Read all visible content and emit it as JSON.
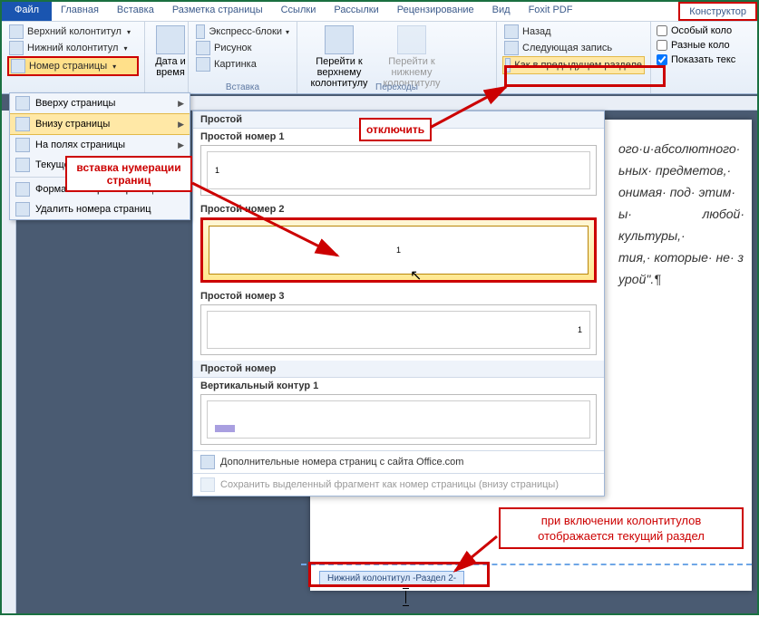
{
  "tabs": {
    "file": "Файл",
    "home": "Главная",
    "insert": "Вставка",
    "layout": "Разметка страницы",
    "refs": "Ссылки",
    "mail": "Рассылки",
    "review": "Рецензирование",
    "view": "Вид",
    "foxit": "Foxit PDF",
    "constructor": "Конструктор"
  },
  "ribbon": {
    "hf": {
      "header": "Верхний колонтитул",
      "footer": "Нижний колонтитул",
      "pagenum": "Номер страницы"
    },
    "datetime": {
      "label": "Дата и время"
    },
    "insert": {
      "express": "Экспресс-блоки",
      "picture": "Рисунок",
      "clipart": "Картинка",
      "group": "Вставка"
    },
    "nav": {
      "gotoHeader": "Перейти к верхнему колонтитулу",
      "gotoFooter": "Перейти к нижнему колонтитулу",
      "group": "Переходы",
      "back": "Назад",
      "next": "Следующая запись",
      "linkprev": "Как в предыдущем разделе"
    },
    "opts": {
      "special": "Особый коло",
      "diff": "Разные коло",
      "showtext": "Показать текс"
    }
  },
  "dropdown": {
    "top": "Вверху страницы",
    "bottom": "Внизу страницы",
    "margins": "На полях страницы",
    "current": "Текущее положение",
    "format": "Формат номеров страниц...",
    "remove": "Удалить номера страниц"
  },
  "gallery": {
    "simple": "Простой",
    "n1": "Простой номер 1",
    "n2": "Простой номер 2",
    "n3": "Простой номер 3",
    "simpleNum": "Простой номер",
    "vcontour": "Вертикальный контур 1",
    "more": "Дополнительные номера страниц с сайта Office.com",
    "save": "Сохранить выделенный фрагмент как номер страницы (внизу страницы)",
    "samplenum": "1"
  },
  "callouts": {
    "insert": "вставка нумерации страниц",
    "disable": "отключить",
    "footersect": "при включении колонтитулов отображается текущий раздел"
  },
  "doc": {
    "line1": "ого·и·абсолютного·",
    "line2": "ьных· предметов,·",
    "line3": "онимая· под· этим·",
    "line4": "ы· любой· культуры,·",
    "line5": "тия,· которые· не· з",
    "line6": "урой\".¶",
    "footerLabel": "Нижний колонтитул -Раздел 2-"
  }
}
